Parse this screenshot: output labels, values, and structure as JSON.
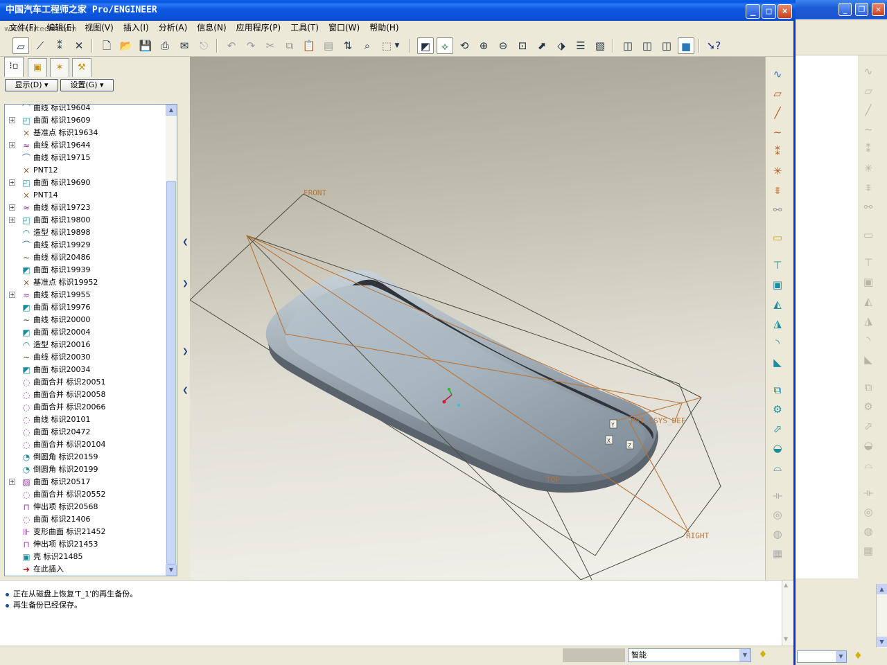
{
  "window": {
    "title": "中国汽车工程师之家 Pro/ENGINEER",
    "watermark": "www.cartech8.com"
  },
  "menu": [
    "文件(F)",
    "编辑(E)",
    "视图(V)",
    "插入(I)",
    "分析(A)",
    "信息(N)",
    "应用程序(P)",
    "工具(T)",
    "窗口(W)",
    "帮助(H)"
  ],
  "panel": {
    "display_button": "显示(D) ▾",
    "settings_button": "设置(G) ▾"
  },
  "tree": [
    {
      "icon": "curve-icon",
      "glyph": "⌒",
      "color": "#2a6cc8",
      "label": "曲线 标识19604",
      "expand": false
    },
    {
      "icon": "surface-icon",
      "glyph": "◰",
      "color": "#1a8ca0",
      "label": "曲面 标识19609",
      "expand": true
    },
    {
      "icon": "datum-point-icon",
      "glyph": "×",
      "color": "#8a5a2a",
      "label": "基准点 标识19634",
      "expand": false
    },
    {
      "icon": "curve-icon",
      "glyph": "≈",
      "color": "#8a3aa8",
      "label": "曲线 标识19644",
      "expand": true
    },
    {
      "icon": "curve-icon",
      "glyph": "⌒",
      "color": "#2a6cc8",
      "label": "曲线 标识19715",
      "expand": false
    },
    {
      "icon": "datum-point-icon",
      "glyph": "×",
      "color": "#8a5a2a",
      "label": "PNT12",
      "expand": false
    },
    {
      "icon": "surface-icon",
      "glyph": "◰",
      "color": "#1a8ca0",
      "label": "曲面 标识19690",
      "expand": true
    },
    {
      "icon": "datum-point-icon",
      "glyph": "×",
      "color": "#8a5a2a",
      "label": "PNT14",
      "expand": false
    },
    {
      "icon": "curve-icon",
      "glyph": "≈",
      "color": "#8a3aa8",
      "label": "曲线 标识19723",
      "expand": true
    },
    {
      "icon": "surface-icon",
      "glyph": "◰",
      "color": "#1a8ca0",
      "label": "曲面 标识19800",
      "expand": true
    },
    {
      "icon": "style-icon",
      "glyph": "◠",
      "color": "#1a8ca0",
      "label": "造型 标识19898",
      "expand": false
    },
    {
      "icon": "curve-icon",
      "glyph": "⌒",
      "color": "#2a6cc8",
      "label": "曲线 标识19929",
      "expand": false
    },
    {
      "icon": "curve-icon",
      "glyph": "∼",
      "color": "#5a4a2a",
      "label": "曲线 标识20486",
      "expand": false
    },
    {
      "icon": "surface-icon",
      "glyph": "◩",
      "color": "#1a8ca0",
      "label": "曲面 标识19939",
      "expand": false
    },
    {
      "icon": "datum-point-icon",
      "glyph": "×",
      "color": "#8a5a2a",
      "label": "基准点 标识19952",
      "expand": false
    },
    {
      "icon": "curve-icon",
      "glyph": "≈",
      "color": "#8a3aa8",
      "label": "曲线 标识19955",
      "expand": true
    },
    {
      "icon": "surface-icon",
      "glyph": "◩",
      "color": "#1a8ca0",
      "label": "曲面 标识19976",
      "expand": false
    },
    {
      "icon": "curve-icon",
      "glyph": "∼",
      "color": "#5a4a2a",
      "label": "曲线 标识20000",
      "expand": false
    },
    {
      "icon": "surface-icon",
      "glyph": "◩",
      "color": "#1a8ca0",
      "label": "曲面 标识20004",
      "expand": false
    },
    {
      "icon": "style-icon",
      "glyph": "◠",
      "color": "#1a8ca0",
      "label": "造型 标识20016",
      "expand": false
    },
    {
      "icon": "curve-icon",
      "glyph": "∼",
      "color": "#5a4a2a",
      "label": "曲线 标识20030",
      "expand": false
    },
    {
      "icon": "surface-icon",
      "glyph": "◩",
      "color": "#1a8ca0",
      "label": "曲面 标识20034",
      "expand": false
    },
    {
      "icon": "merge-icon",
      "glyph": "◌",
      "color": "#9a3aa8",
      "label": "曲面合并 标识20051",
      "expand": false
    },
    {
      "icon": "merge-icon",
      "glyph": "◌",
      "color": "#9a3aa8",
      "label": "曲面合并 标识20058",
      "expand": false
    },
    {
      "icon": "merge-icon",
      "glyph": "◌",
      "color": "#9a3aa8",
      "label": "曲面合并 标识20066",
      "expand": false
    },
    {
      "icon": "curve-icon",
      "glyph": "◌",
      "color": "#9a3aa8",
      "label": "曲线 标识20101",
      "expand": false
    },
    {
      "icon": "surface-icon",
      "glyph": "◌",
      "color": "#9a3aa8",
      "label": "曲面 标识20472",
      "expand": false
    },
    {
      "icon": "merge-icon",
      "glyph": "◌",
      "color": "#9a3aa8",
      "label": "曲面合并 标识20104",
      "expand": false
    },
    {
      "icon": "round-icon",
      "glyph": "◔",
      "color": "#1a8ca0",
      "label": "倒圆角 标识20159",
      "expand": false
    },
    {
      "icon": "round-icon",
      "glyph": "◔",
      "color": "#1a8ca0",
      "label": "倒圆角 标识20199",
      "expand": false
    },
    {
      "icon": "surface-icon",
      "glyph": "▨",
      "color": "#9a3aa8",
      "label": "曲面 标识20517",
      "expand": true
    },
    {
      "icon": "merge-icon",
      "glyph": "◌",
      "color": "#9a3aa8",
      "label": "曲面合并 标识20552",
      "expand": false
    },
    {
      "icon": "extrude-icon",
      "glyph": "⊓",
      "color": "#9a3aa8",
      "label": "伸出项 标识20568",
      "expand": false
    },
    {
      "icon": "surface-icon",
      "glyph": "◌",
      "color": "#9a3aa8",
      "label": "曲面 标识21406",
      "expand": false
    },
    {
      "icon": "warp-icon",
      "glyph": "⊪",
      "color": "#9a3aa8",
      "label": "变形曲面 标识21452",
      "expand": false
    },
    {
      "icon": "extrude-icon",
      "glyph": "⊓",
      "color": "#9a3aa8",
      "label": "伸出项 标识21453",
      "expand": false
    },
    {
      "icon": "shell-icon",
      "glyph": "▣",
      "color": "#1a8ca0",
      "label": "壳 标识21485",
      "expand": false
    },
    {
      "icon": "insert-here-icon",
      "glyph": "➜",
      "color": "#c8141e",
      "label": "在此插入",
      "expand": false
    }
  ],
  "canvas": {
    "datums": [
      "FRONT",
      "TOP",
      "RIGHT",
      "PRT_CSYS_DEF"
    ],
    "axis_labels": [
      "Y",
      "X",
      "Z"
    ]
  },
  "messages": [
    "正在从磁盘上恢复'T_1'的再生备份。",
    "再生备份已经保存。"
  ],
  "status": {
    "filter": "智能"
  }
}
